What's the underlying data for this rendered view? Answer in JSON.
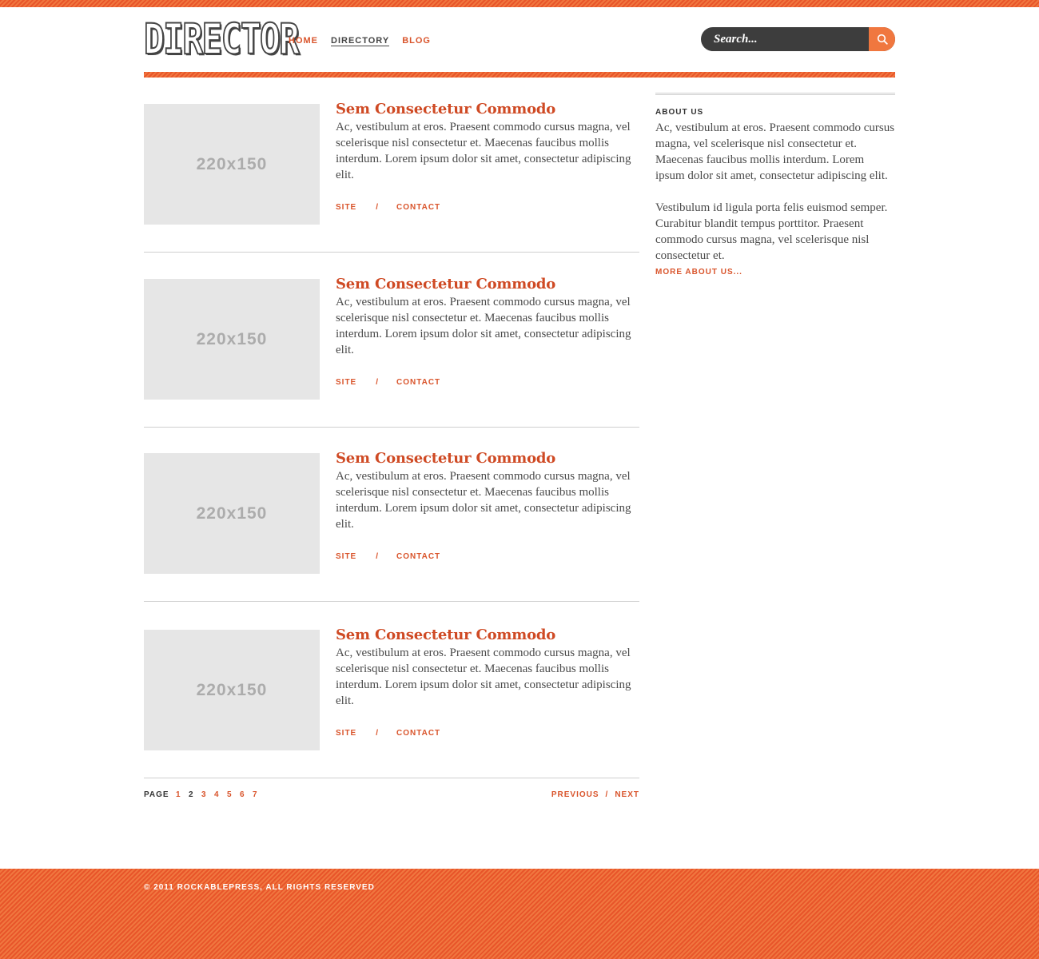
{
  "brand": {
    "logo_text": "DIRECTOR"
  },
  "nav": {
    "items": [
      {
        "label": "HOME"
      },
      {
        "label": "DIRECTORY"
      },
      {
        "label": "BLOG"
      }
    ]
  },
  "search": {
    "placeholder": "Search..."
  },
  "posts": [
    {
      "thumb": "220x150",
      "title": "Sem Consectetur Commodo",
      "body": "Ac, vestibulum at eros. Praesent commodo cursus magna, vel scelerisque nisl consectetur et. Maecenas faucibus mollis interdum. Lorem ipsum dolor sit amet, consectetur adipiscing elit.",
      "link_site": "SITE",
      "link_sep": "/",
      "link_contact": "CONTACT"
    },
    {
      "thumb": "220x150",
      "title": "Sem Consectetur Commodo",
      "body": "Ac, vestibulum at eros. Praesent commodo cursus magna, vel scelerisque nisl consectetur et. Maecenas faucibus mollis interdum. Lorem ipsum dolor sit amet, consectetur adipiscing elit.",
      "link_site": "SITE",
      "link_sep": "/",
      "link_contact": "CONTACT"
    },
    {
      "thumb": "220x150",
      "title": "Sem Consectetur Commodo",
      "body": "Ac, vestibulum at eros. Praesent commodo cursus magna, vel scelerisque nisl consectetur et. Maecenas faucibus mollis interdum. Lorem ipsum dolor sit amet, consectetur adipiscing elit.",
      "link_site": "SITE",
      "link_sep": "/",
      "link_contact": "CONTACT"
    },
    {
      "thumb": "220x150",
      "title": "Sem Consectetur Commodo",
      "body": "Ac, vestibulum at eros. Praesent commodo cursus magna, vel scelerisque nisl consectetur et. Maecenas faucibus mollis interdum. Lorem ipsum dolor sit amet, consectetur adipiscing elit.",
      "link_site": "SITE",
      "link_sep": "/",
      "link_contact": "CONTACT"
    }
  ],
  "pagination": {
    "label": "PAGE",
    "pages": [
      "1",
      "2",
      "3",
      "4",
      "5",
      "6",
      "7"
    ],
    "current": "2",
    "previous": "PREVIOUS",
    "sep": "/",
    "next": "NEXT"
  },
  "sidebar": {
    "heading": "ABOUT US",
    "paragraph1": "Ac, vestibulum at eros. Praesent commodo cursus magna, vel scelerisque nisl consectetur et. Maecenas faucibus mollis interdum. Lorem ipsum dolor sit amet, consectetur adipiscing elit.",
    "paragraph2": "Vestibulum id ligula porta felis euismod semper. Curabitur blandit tempus porttitor. Praesent commodo cursus magna, vel scelerisque nisl consectetur et.",
    "more_link": "MORE ABOUT US..."
  },
  "footer": {
    "copyright": "© 2011 ROCKABLEPRESS, ALL RIGHTS RESERVED"
  },
  "colors": {
    "accent": "#d9542b",
    "stripe": "#f0773f",
    "dark": "#3d3d3d",
    "placeholder": "#e6e6e6"
  }
}
